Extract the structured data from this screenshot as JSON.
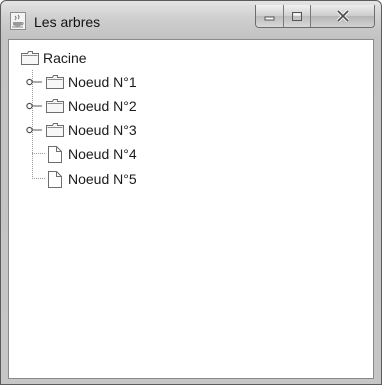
{
  "window": {
    "title": "Les arbres",
    "controls": [
      "minimize-icon",
      "maximize-icon",
      "close-icon"
    ]
  },
  "tree": {
    "root": {
      "label": "Racine",
      "icon": "folder-icon"
    },
    "children": [
      {
        "label": "Noeud N°1",
        "icon": "folder-icon",
        "expandable": true
      },
      {
        "label": "Noeud N°2",
        "icon": "folder-icon",
        "expandable": true
      },
      {
        "label": "Noeud N°3",
        "icon": "folder-icon",
        "expandable": true
      },
      {
        "label": "Noeud N°4",
        "icon": "file-icon",
        "expandable": false
      },
      {
        "label": "Noeud N°5",
        "icon": "file-icon",
        "expandable": false
      }
    ]
  }
}
